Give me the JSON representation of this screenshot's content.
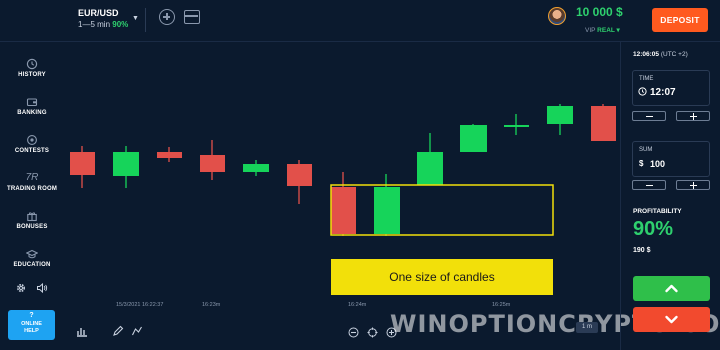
{
  "header": {
    "asset": "EUR/USD",
    "duration": "1—5 min",
    "payout_pct": "90%",
    "caret": "▼",
    "balance": "10 000 $",
    "account_prefix": "VIP",
    "account_type": "REAL ▾",
    "deposit_label": "DEPOSIT"
  },
  "sidebar": {
    "items": [
      {
        "label": "HISTORY",
        "icon": "history-icon"
      },
      {
        "label": "BANKING",
        "icon": "wallet-icon"
      },
      {
        "label": "CONTESTS",
        "icon": "contests-icon"
      },
      {
        "label": "TRADING ROOM",
        "icon": "trading-room-icon",
        "glyph": "7R"
      },
      {
        "label": "BONUSES",
        "icon": "gift-icon"
      },
      {
        "label": "EDUCATION",
        "icon": "graduation-cap-icon"
      }
    ],
    "help_symbol": "?",
    "help_line1": "ONLINE",
    "help_line2": "HELP"
  },
  "chart": {
    "time_labels": [
      "15/3/2021 16:22:37",
      "16:23m",
      "16:24m",
      "16:25m"
    ],
    "annotation": "One size of candles",
    "interval": "1 m",
    "watermark": "WINOPTIONCRYPTO.COM",
    "colors": {
      "up": "#16d45a",
      "down": "#e2504a",
      "highlight": "#f2e00a"
    }
  },
  "right": {
    "clock_time": "12:06:05",
    "clock_tz": "(UTC +2)",
    "time_label": "TIME",
    "time_value": "12:07",
    "sum_label": "SUM",
    "sum_currency": "$",
    "sum_value": "100",
    "profit_label": "PROFITABILITY",
    "profit_value": "90%",
    "payout_value": "190 $"
  },
  "colors": {
    "background": "#0b1a2e",
    "accent_green": "#2ed06e",
    "deposit": "#ff5a1f",
    "help": "#1ea3f2",
    "up_button": "#2fbf4a",
    "down_button": "#f24a2e"
  }
}
